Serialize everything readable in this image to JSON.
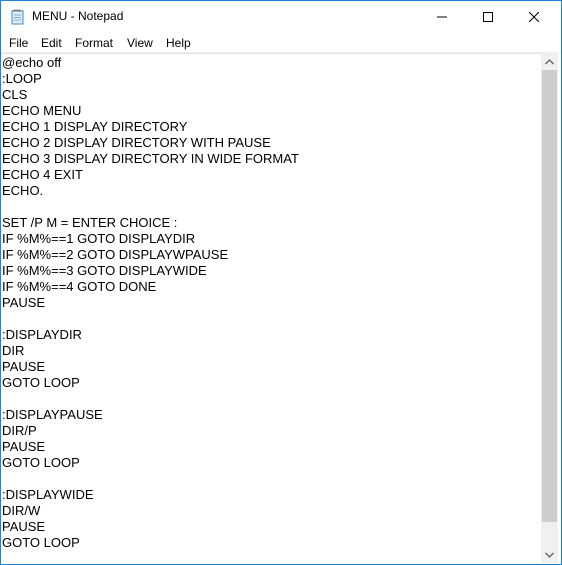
{
  "window": {
    "title": "MENU - Notepad",
    "app_icon": "notepad-icon",
    "controls": [
      "minimize-icon",
      "maximize-icon",
      "close-icon"
    ],
    "border_color": "#1883d7"
  },
  "menubar": {
    "items": [
      {
        "label": "File"
      },
      {
        "label": "Edit"
      },
      {
        "label": "Format"
      },
      {
        "label": "View"
      },
      {
        "label": "Help"
      }
    ]
  },
  "editor": {
    "lines": [
      "@echo off",
      ":LOOP",
      "CLS",
      "ECHO MENU",
      "ECHO 1 DISPLAY DIRECTORY",
      "ECHO 2 DISPLAY DIRECTORY WITH PAUSE",
      "ECHO 3 DISPLAY DIRECTORY IN WIDE FORMAT",
      "ECHO 4 EXIT",
      "ECHO.",
      "",
      "SET /P M = ENTER CHOICE :",
      "IF %M%==1 GOTO DISPLAYDIR",
      "IF %M%==2 GOTO DISPLAYWPAUSE",
      "IF %M%==3 GOTO DISPLAYWIDE",
      "IF %M%==4 GOTO DONE",
      "PAUSE",
      "",
      ":DISPLAYDIR",
      "DIR",
      "PAUSE",
      "GOTO LOOP",
      "",
      ":DISPLAYPAUSE",
      "DIR/P",
      "PAUSE",
      "GOTO LOOP",
      "",
      ":DISPLAYWIDE",
      "DIR/W",
      "PAUSE",
      "GOTO LOOP"
    ]
  },
  "scrollbar": {
    "up_icon": "scroll-up-arrow-icon",
    "down_icon": "scroll-down-arrow-icon"
  }
}
